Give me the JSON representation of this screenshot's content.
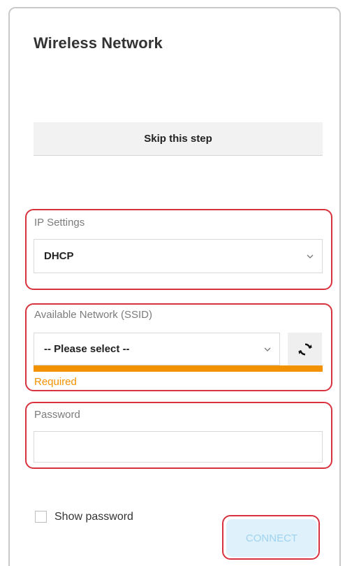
{
  "dialog": {
    "title": "Wireless Network",
    "skip_label": "Skip this step"
  },
  "ip_settings": {
    "label": "IP Settings",
    "value": "DHCP",
    "icon": "chevron-down-icon"
  },
  "ssid": {
    "label": "Available Network (SSID)",
    "value": "-- Please select --",
    "icon": "chevron-down-icon",
    "refresh_icon": "refresh-icon",
    "error": "Required",
    "error_color": "#f39200"
  },
  "password": {
    "label": "Password",
    "value": "",
    "placeholder": ""
  },
  "show_password": {
    "label": "Show password",
    "checked": false
  },
  "connect": {
    "label": "CONNECT",
    "enabled": false
  },
  "colors": {
    "highlight": "#d8323e",
    "accent_orange": "#f39200",
    "button_disabled_bg": "#dff1fb"
  }
}
